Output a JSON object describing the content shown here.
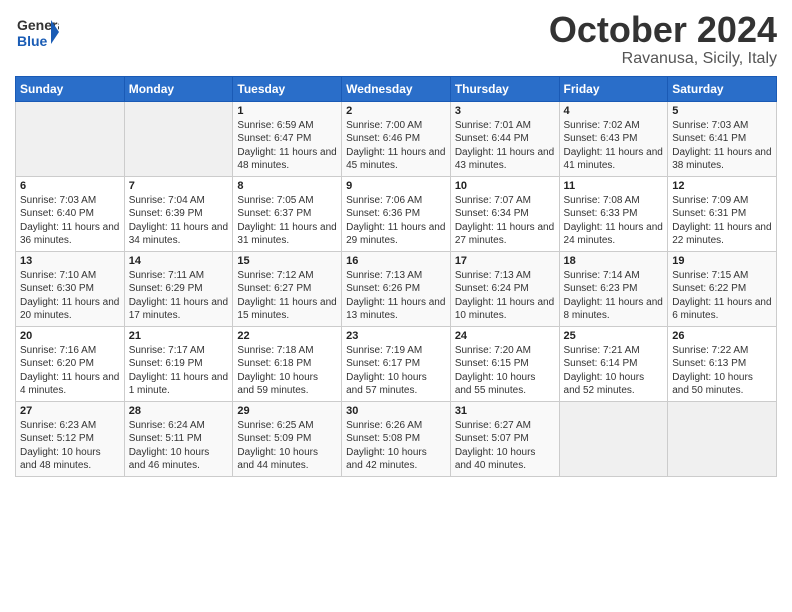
{
  "header": {
    "logo_line1": "General",
    "logo_line2": "Blue",
    "title": "October 2024",
    "subtitle": "Ravanusa, Sicily, Italy"
  },
  "weekdays": [
    "Sunday",
    "Monday",
    "Tuesday",
    "Wednesday",
    "Thursday",
    "Friday",
    "Saturday"
  ],
  "weeks": [
    [
      {
        "day": "",
        "empty": true
      },
      {
        "day": "",
        "empty": true
      },
      {
        "day": "1",
        "sunrise": "Sunrise: 6:59 AM",
        "sunset": "Sunset: 6:47 PM",
        "daylight": "Daylight: 11 hours and 48 minutes."
      },
      {
        "day": "2",
        "sunrise": "Sunrise: 7:00 AM",
        "sunset": "Sunset: 6:46 PM",
        "daylight": "Daylight: 11 hours and 45 minutes."
      },
      {
        "day": "3",
        "sunrise": "Sunrise: 7:01 AM",
        "sunset": "Sunset: 6:44 PM",
        "daylight": "Daylight: 11 hours and 43 minutes."
      },
      {
        "day": "4",
        "sunrise": "Sunrise: 7:02 AM",
        "sunset": "Sunset: 6:43 PM",
        "daylight": "Daylight: 11 hours and 41 minutes."
      },
      {
        "day": "5",
        "sunrise": "Sunrise: 7:03 AM",
        "sunset": "Sunset: 6:41 PM",
        "daylight": "Daylight: 11 hours and 38 minutes."
      }
    ],
    [
      {
        "day": "6",
        "sunrise": "Sunrise: 7:03 AM",
        "sunset": "Sunset: 6:40 PM",
        "daylight": "Daylight: 11 hours and 36 minutes."
      },
      {
        "day": "7",
        "sunrise": "Sunrise: 7:04 AM",
        "sunset": "Sunset: 6:39 PM",
        "daylight": "Daylight: 11 hours and 34 minutes."
      },
      {
        "day": "8",
        "sunrise": "Sunrise: 7:05 AM",
        "sunset": "Sunset: 6:37 PM",
        "daylight": "Daylight: 11 hours and 31 minutes."
      },
      {
        "day": "9",
        "sunrise": "Sunrise: 7:06 AM",
        "sunset": "Sunset: 6:36 PM",
        "daylight": "Daylight: 11 hours and 29 minutes."
      },
      {
        "day": "10",
        "sunrise": "Sunrise: 7:07 AM",
        "sunset": "Sunset: 6:34 PM",
        "daylight": "Daylight: 11 hours and 27 minutes."
      },
      {
        "day": "11",
        "sunrise": "Sunrise: 7:08 AM",
        "sunset": "Sunset: 6:33 PM",
        "daylight": "Daylight: 11 hours and 24 minutes."
      },
      {
        "day": "12",
        "sunrise": "Sunrise: 7:09 AM",
        "sunset": "Sunset: 6:31 PM",
        "daylight": "Daylight: 11 hours and 22 minutes."
      }
    ],
    [
      {
        "day": "13",
        "sunrise": "Sunrise: 7:10 AM",
        "sunset": "Sunset: 6:30 PM",
        "daylight": "Daylight: 11 hours and 20 minutes."
      },
      {
        "day": "14",
        "sunrise": "Sunrise: 7:11 AM",
        "sunset": "Sunset: 6:29 PM",
        "daylight": "Daylight: 11 hours and 17 minutes."
      },
      {
        "day": "15",
        "sunrise": "Sunrise: 7:12 AM",
        "sunset": "Sunset: 6:27 PM",
        "daylight": "Daylight: 11 hours and 15 minutes."
      },
      {
        "day": "16",
        "sunrise": "Sunrise: 7:13 AM",
        "sunset": "Sunset: 6:26 PM",
        "daylight": "Daylight: 11 hours and 13 minutes."
      },
      {
        "day": "17",
        "sunrise": "Sunrise: 7:13 AM",
        "sunset": "Sunset: 6:24 PM",
        "daylight": "Daylight: 11 hours and 10 minutes."
      },
      {
        "day": "18",
        "sunrise": "Sunrise: 7:14 AM",
        "sunset": "Sunset: 6:23 PM",
        "daylight": "Daylight: 11 hours and 8 minutes."
      },
      {
        "day": "19",
        "sunrise": "Sunrise: 7:15 AM",
        "sunset": "Sunset: 6:22 PM",
        "daylight": "Daylight: 11 hours and 6 minutes."
      }
    ],
    [
      {
        "day": "20",
        "sunrise": "Sunrise: 7:16 AM",
        "sunset": "Sunset: 6:20 PM",
        "daylight": "Daylight: 11 hours and 4 minutes."
      },
      {
        "day": "21",
        "sunrise": "Sunrise: 7:17 AM",
        "sunset": "Sunset: 6:19 PM",
        "daylight": "Daylight: 11 hours and 1 minute."
      },
      {
        "day": "22",
        "sunrise": "Sunrise: 7:18 AM",
        "sunset": "Sunset: 6:18 PM",
        "daylight": "Daylight: 10 hours and 59 minutes."
      },
      {
        "day": "23",
        "sunrise": "Sunrise: 7:19 AM",
        "sunset": "Sunset: 6:17 PM",
        "daylight": "Daylight: 10 hours and 57 minutes."
      },
      {
        "day": "24",
        "sunrise": "Sunrise: 7:20 AM",
        "sunset": "Sunset: 6:15 PM",
        "daylight": "Daylight: 10 hours and 55 minutes."
      },
      {
        "day": "25",
        "sunrise": "Sunrise: 7:21 AM",
        "sunset": "Sunset: 6:14 PM",
        "daylight": "Daylight: 10 hours and 52 minutes."
      },
      {
        "day": "26",
        "sunrise": "Sunrise: 7:22 AM",
        "sunset": "Sunset: 6:13 PM",
        "daylight": "Daylight: 10 hours and 50 minutes."
      }
    ],
    [
      {
        "day": "27",
        "sunrise": "Sunrise: 6:23 AM",
        "sunset": "Sunset: 5:12 PM",
        "daylight": "Daylight: 10 hours and 48 minutes."
      },
      {
        "day": "28",
        "sunrise": "Sunrise: 6:24 AM",
        "sunset": "Sunset: 5:11 PM",
        "daylight": "Daylight: 10 hours and 46 minutes."
      },
      {
        "day": "29",
        "sunrise": "Sunrise: 6:25 AM",
        "sunset": "Sunset: 5:09 PM",
        "daylight": "Daylight: 10 hours and 44 minutes."
      },
      {
        "day": "30",
        "sunrise": "Sunrise: 6:26 AM",
        "sunset": "Sunset: 5:08 PM",
        "daylight": "Daylight: 10 hours and 42 minutes."
      },
      {
        "day": "31",
        "sunrise": "Sunrise: 6:27 AM",
        "sunset": "Sunset: 5:07 PM",
        "daylight": "Daylight: 10 hours and 40 minutes."
      },
      {
        "day": "",
        "empty": true
      },
      {
        "day": "",
        "empty": true
      }
    ]
  ]
}
